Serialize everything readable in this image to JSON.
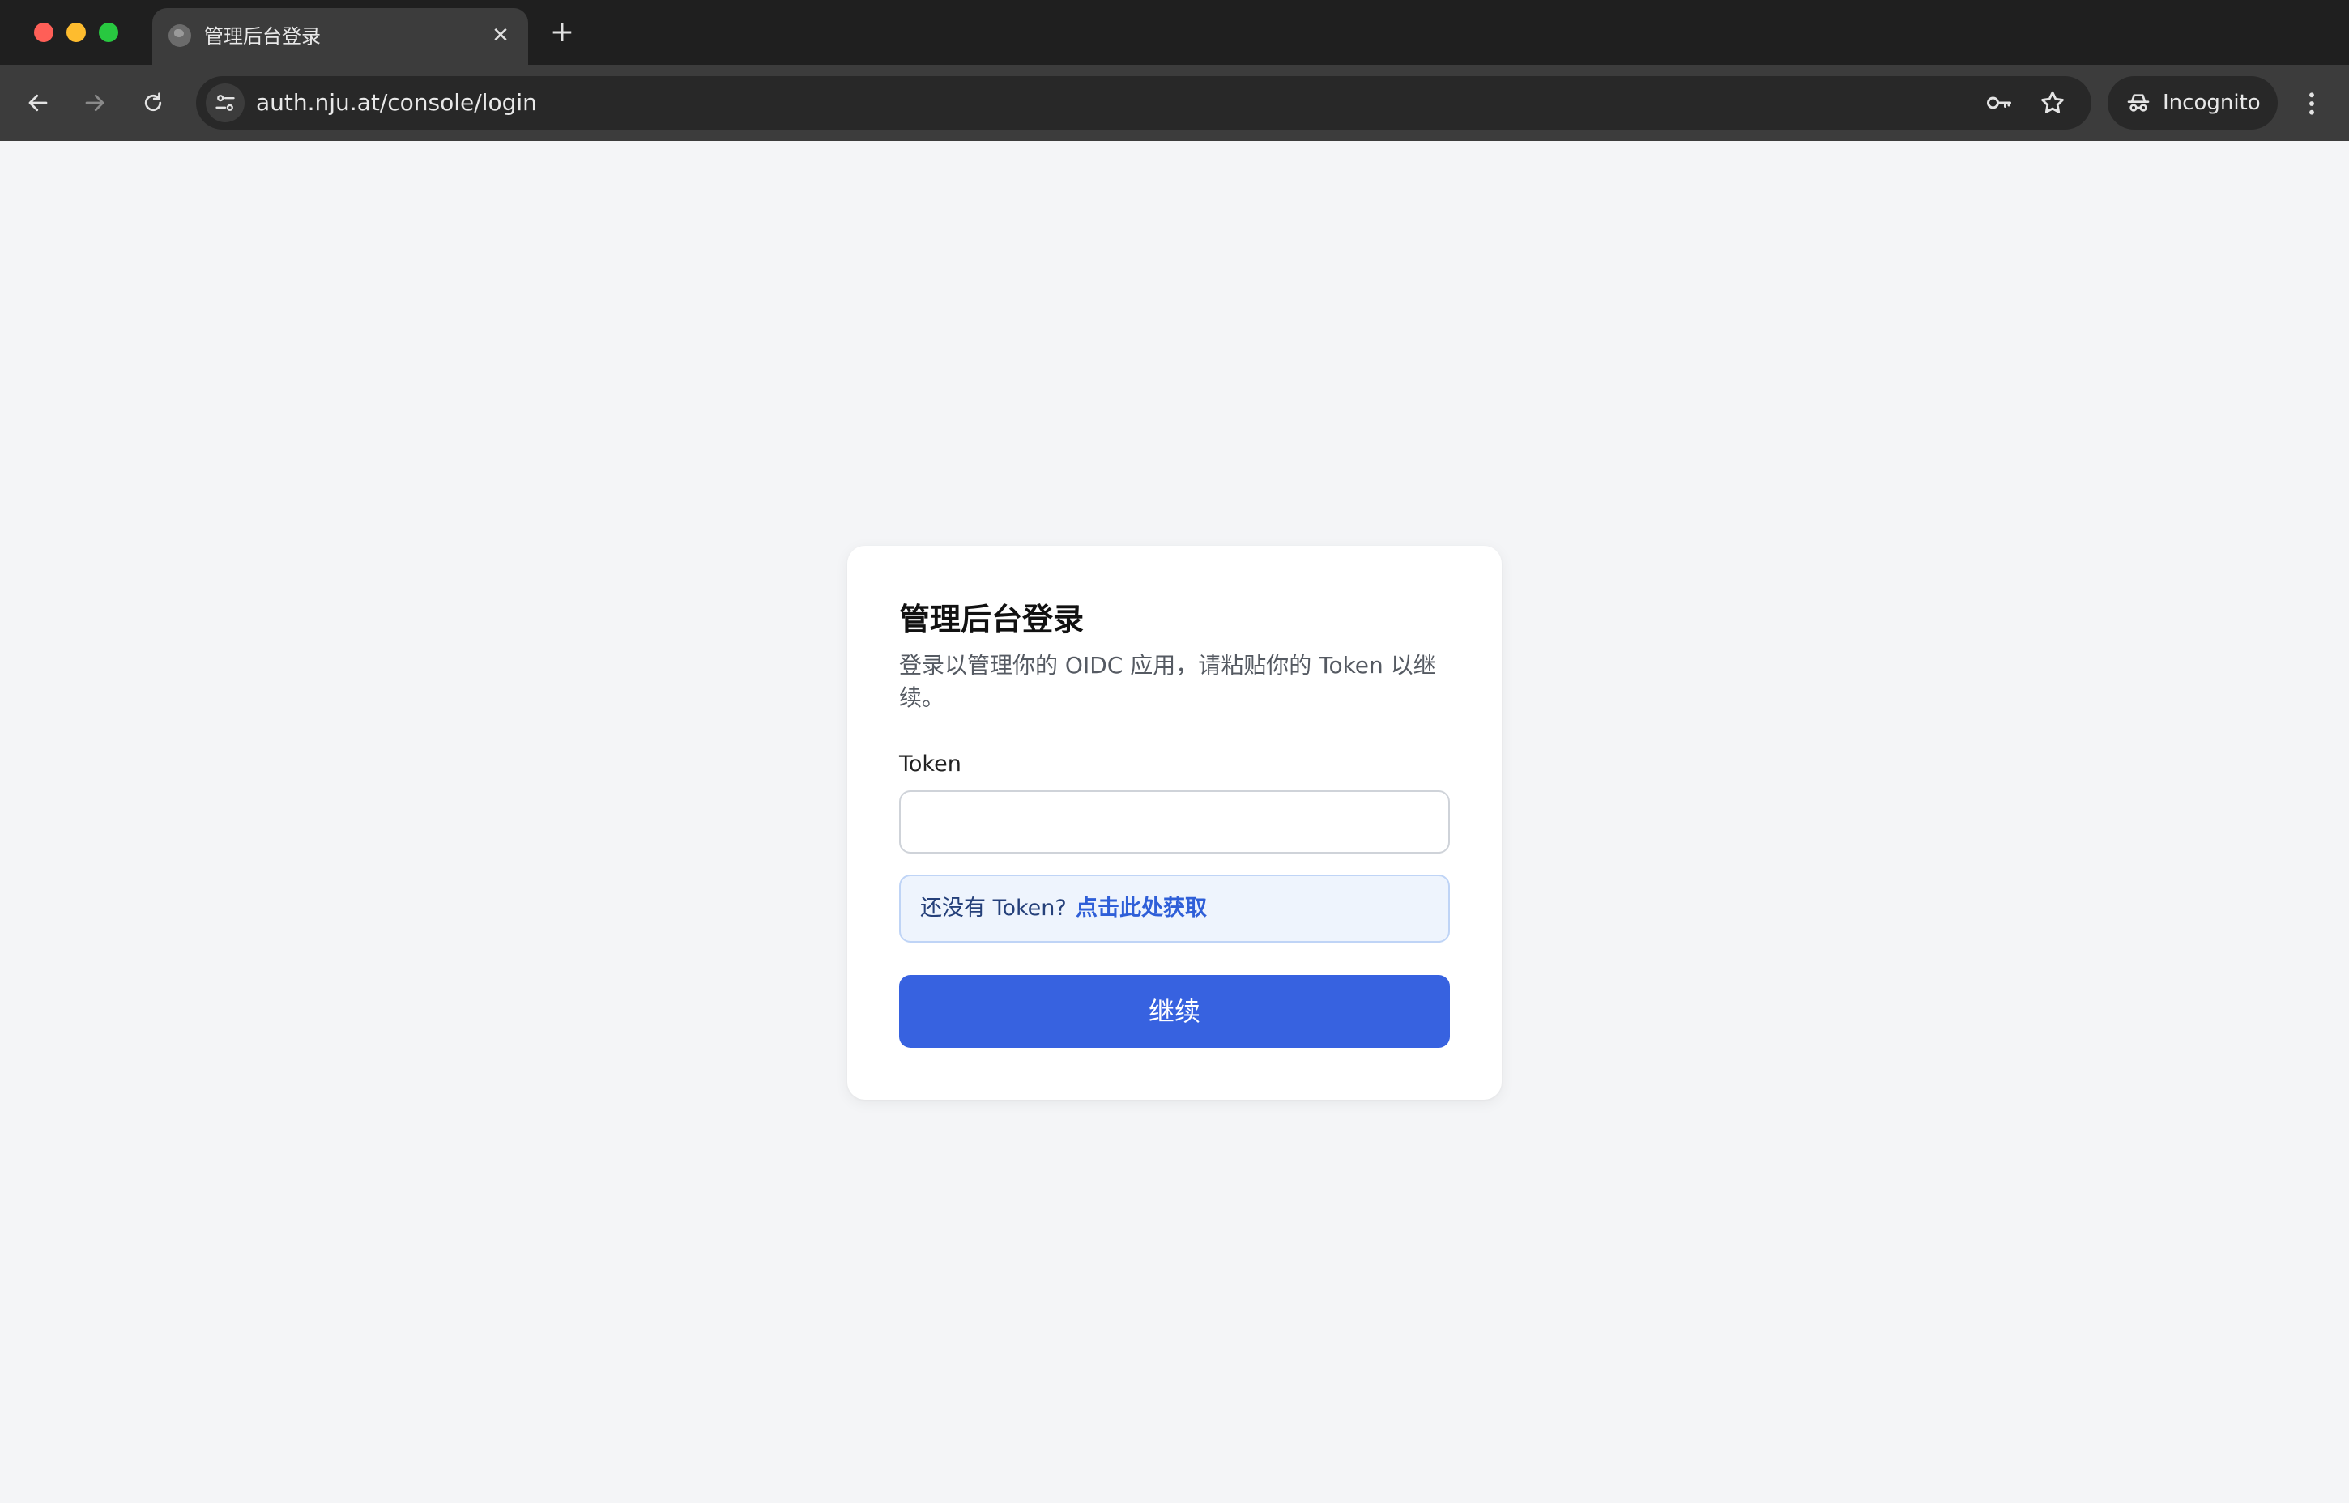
{
  "browser": {
    "tab": {
      "title": "管理后台登录",
      "close_glyph": "✕"
    },
    "new_tab_glyph": "+",
    "address": {
      "url": "auth.nju.at/console/login"
    },
    "incognito_label": "Incognito",
    "icons": {
      "back": "arrow-left-icon",
      "forward": "arrow-right-icon",
      "reload": "reload-icon",
      "site_info": "tune-icon",
      "password": "key-icon",
      "bookmark": "star-icon",
      "incognito": "incognito-icon",
      "menu": "vertical-dots-icon"
    }
  },
  "login": {
    "title": "管理后台登录",
    "subtitle": "登录以管理你的 OIDC 应用，请粘贴你的 Token 以继续。",
    "token_label": "Token",
    "token_value": "",
    "hint_text": "还没有 Token?",
    "hint_link": "点击此处获取",
    "continue_label": "继续"
  },
  "colors": {
    "page_bg": "#f4f5f7",
    "primary": "#3762e0",
    "hint_bg": "#eef4fd",
    "link": "#2f5fd8"
  }
}
